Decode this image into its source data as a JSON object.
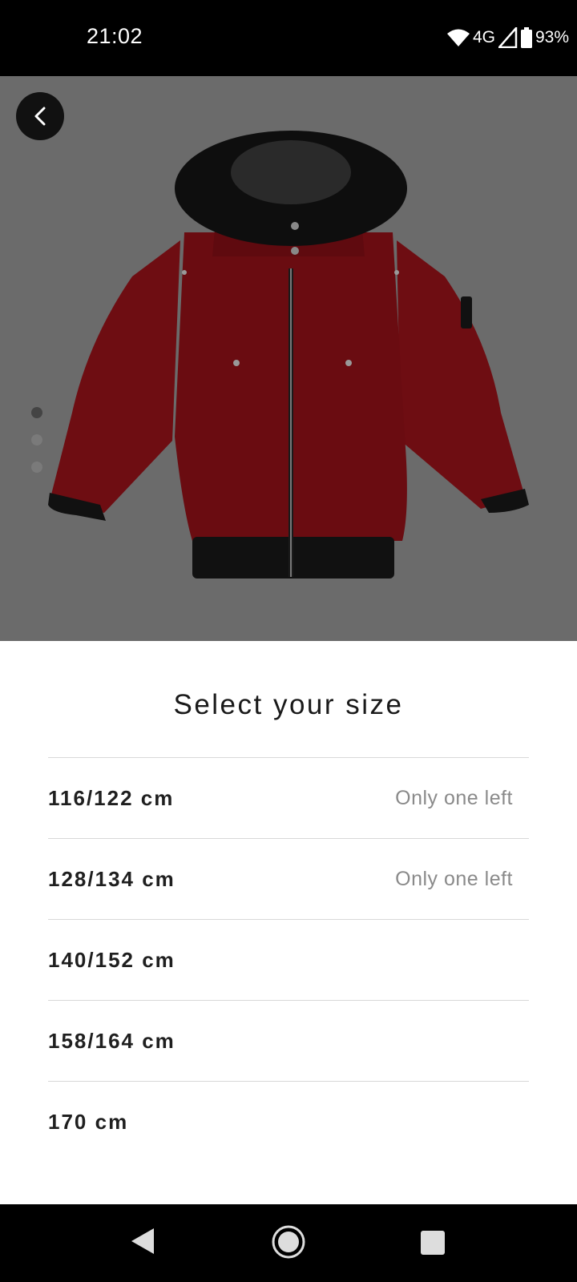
{
  "status_bar": {
    "time": "21:02",
    "network": "4G",
    "battery": "93%",
    "icons": [
      "wifi-icon",
      "cell-signal-icon",
      "battery-icon"
    ]
  },
  "product": {
    "image": "red-hooded-bomber-jacket",
    "carousel_pages": 3,
    "carousel_active_index": 0
  },
  "size_sheet": {
    "title": "Select your size",
    "sizes": [
      {
        "label": "116/122 cm",
        "note": "Only one left"
      },
      {
        "label": "128/134 cm",
        "note": "Only one left"
      },
      {
        "label": "140/152 cm",
        "note": ""
      },
      {
        "label": "158/164 cm",
        "note": ""
      },
      {
        "label": "170 cm",
        "note": ""
      }
    ]
  },
  "colors": {
    "overlay": "#6b6b6b",
    "jacket": "#6e0d12",
    "text_primary": "#1f1f1f",
    "text_muted": "#8a8a8a"
  },
  "nav_bar": {
    "buttons": [
      "back-triangle-icon",
      "home-circle-icon",
      "recents-square-icon"
    ]
  }
}
